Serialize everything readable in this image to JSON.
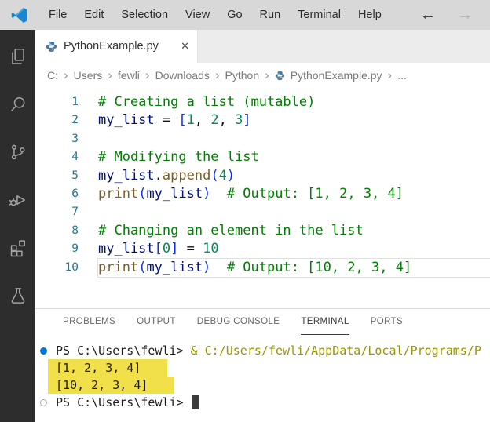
{
  "titlebar": {
    "menu": [
      "File",
      "Edit",
      "Selection",
      "View",
      "Go",
      "Run",
      "Terminal",
      "Help"
    ],
    "nav_back": "←",
    "nav_forward": "→"
  },
  "activity_bar": {
    "icons": [
      "explorer",
      "search",
      "source-control",
      "run-and-debug",
      "extensions",
      "testing"
    ]
  },
  "editor": {
    "tab": {
      "label": "PythonExample.py",
      "close_glyph": "✕"
    },
    "breadcrumb": {
      "items": [
        "C:",
        "Users",
        "fewli",
        "Downloads",
        "Python",
        "PythonExample.py",
        "..."
      ],
      "separator": "›",
      "file_index": 5
    },
    "lines": [
      {
        "num": 1,
        "current": false,
        "tokens": [
          {
            "t": "# Creating a list (mutable)",
            "c": "comment"
          }
        ]
      },
      {
        "num": 2,
        "current": false,
        "tokens": [
          {
            "t": "my_list",
            "c": "var"
          },
          {
            "t": " = ",
            "c": "plain"
          },
          {
            "t": "[",
            "c": "bracket"
          },
          {
            "t": "1",
            "c": "num"
          },
          {
            "t": ", ",
            "c": "plain"
          },
          {
            "t": "2",
            "c": "num"
          },
          {
            "t": ", ",
            "c": "plain"
          },
          {
            "t": "3",
            "c": "num"
          },
          {
            "t": "]",
            "c": "bracket"
          }
        ]
      },
      {
        "num": 3,
        "current": false,
        "tokens": []
      },
      {
        "num": 4,
        "current": false,
        "tokens": [
          {
            "t": "# Modifying the list",
            "c": "comment"
          }
        ]
      },
      {
        "num": 5,
        "current": false,
        "tokens": [
          {
            "t": "my_list",
            "c": "var"
          },
          {
            "t": ".",
            "c": "plain"
          },
          {
            "t": "append",
            "c": "func"
          },
          {
            "t": "(",
            "c": "bracket"
          },
          {
            "t": "4",
            "c": "num"
          },
          {
            "t": ")",
            "c": "bracket"
          }
        ]
      },
      {
        "num": 6,
        "current": false,
        "tokens": [
          {
            "t": "print",
            "c": "func"
          },
          {
            "t": "(",
            "c": "bracket"
          },
          {
            "t": "my_list",
            "c": "var"
          },
          {
            "t": ")",
            "c": "bracket"
          },
          {
            "t": "  ",
            "c": "plain"
          },
          {
            "t": "# Output: [1, 2, 3, 4]",
            "c": "comment"
          }
        ]
      },
      {
        "num": 7,
        "current": false,
        "tokens": []
      },
      {
        "num": 8,
        "current": false,
        "tokens": [
          {
            "t": "# Changing an element in the list",
            "c": "comment"
          }
        ]
      },
      {
        "num": 9,
        "current": false,
        "tokens": [
          {
            "t": "my_list",
            "c": "var"
          },
          {
            "t": "[",
            "c": "bracket"
          },
          {
            "t": "0",
            "c": "num"
          },
          {
            "t": "]",
            "c": "bracket"
          },
          {
            "t": " = ",
            "c": "plain"
          },
          {
            "t": "10",
            "c": "num"
          }
        ]
      },
      {
        "num": 10,
        "current": true,
        "tokens": [
          {
            "t": "print",
            "c": "func"
          },
          {
            "t": "(",
            "c": "bracket"
          },
          {
            "t": "my_list",
            "c": "var"
          },
          {
            "t": ")",
            "c": "bracket"
          },
          {
            "t": "  ",
            "c": "plain"
          },
          {
            "t": "# Output: [10, 2, 3, 4]",
            "c": "comment"
          }
        ]
      }
    ]
  },
  "panel": {
    "tabs": [
      {
        "label": "PROBLEMS",
        "active": false
      },
      {
        "label": "OUTPUT",
        "active": false
      },
      {
        "label": "DEBUG CONSOLE",
        "active": false
      },
      {
        "label": "TERMINAL",
        "active": true
      },
      {
        "label": "PORTS",
        "active": false
      }
    ]
  },
  "terminal": {
    "lines": [
      {
        "decoration": "blue-dot",
        "cursor": false,
        "segments": [
          {
            "text": "PS C:\\Users\\fewli> ",
            "style": "plain"
          },
          {
            "text": "& C:/Users/fewli/AppData/Local/Programs/P",
            "style": "command"
          }
        ]
      },
      {
        "decoration": "none",
        "cursor": false,
        "segments": [
          {
            "text": "[1, 2, 3, 4]",
            "style": "highlight"
          }
        ]
      },
      {
        "decoration": "none",
        "cursor": false,
        "segments": [
          {
            "text": "[10, 2, 3, 4]",
            "style": "highlight"
          }
        ]
      },
      {
        "decoration": "circle",
        "cursor": true,
        "segments": [
          {
            "text": "PS C:\\Users\\fewli> ",
            "style": "plain"
          }
        ]
      }
    ]
  },
  "colors": {
    "accent_blue": "#0078d4",
    "command_olive": "#969600",
    "highlight_yellow": "#f2e04a",
    "comment_green": "#008000",
    "variable_blue": "#001080",
    "function_brown": "#795e26",
    "number_green": "#098658",
    "bracket_blue": "#0431fa",
    "line_number_teal": "#237893",
    "logo_blue": "#1788cf",
    "python_blue": "#3b7dab",
    "python_steel": "#52789b"
  }
}
